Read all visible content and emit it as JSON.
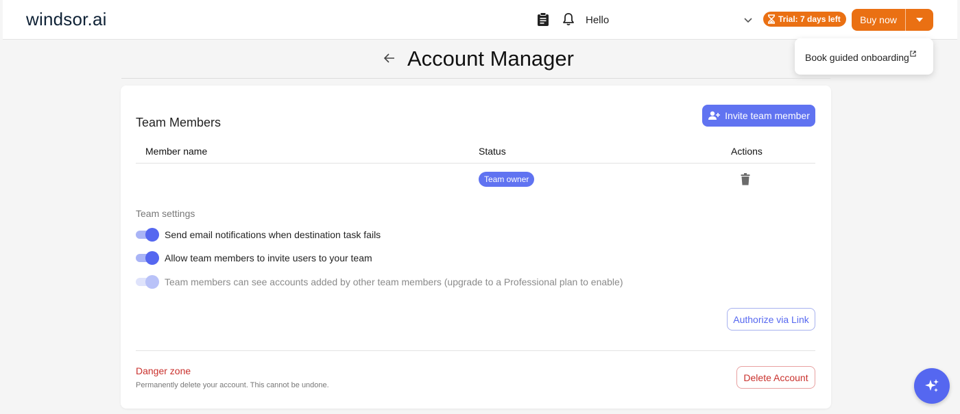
{
  "header": {
    "logo": "windsor.ai",
    "greeting": "Hello",
    "trial_badge": "Trial: 7 days left",
    "buy_now": "Buy now",
    "onboarding_link": "Book guided onboarding",
    "accent_color": "#ea7013"
  },
  "page": {
    "title": "Account Manager"
  },
  "team": {
    "section_title": "Team Members",
    "invite_button": "Invite team member",
    "columns": [
      "Member name",
      "Status",
      "Actions"
    ],
    "rows": [
      {
        "name": "",
        "status": "Team owner"
      }
    ]
  },
  "settings": {
    "label": "Team settings",
    "toggles": [
      {
        "label": "Send email notifications when destination task fails",
        "enabled": true,
        "disabled": false
      },
      {
        "label": "Allow team members to invite users to your team",
        "enabled": true,
        "disabled": false
      },
      {
        "label": "Team members can see accounts added by other team members (upgrade to a Professional plan to enable)",
        "enabled": true,
        "disabled": true
      }
    ],
    "authorize_button": "Authorize via Link"
  },
  "danger": {
    "title": "Danger zone",
    "description": "Permanently delete your account. This cannot be undone.",
    "delete_button": "Delete Account",
    "color": "#c9302c"
  },
  "brand_color": "#5567f0"
}
